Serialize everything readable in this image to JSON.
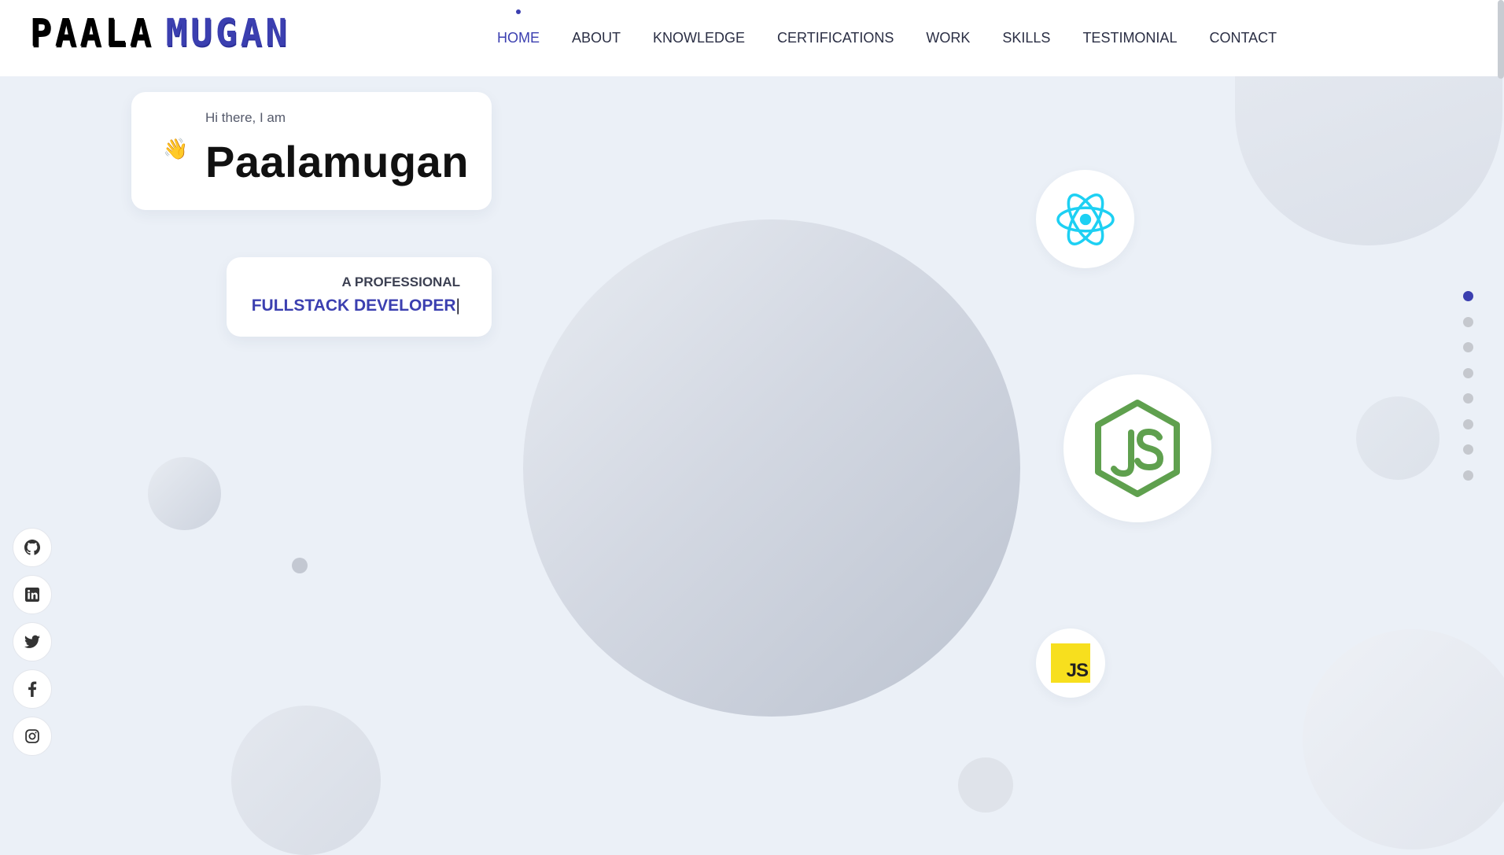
{
  "logo": {
    "part1": "PAALA",
    "part2": "MUGAN"
  },
  "nav": {
    "items": [
      {
        "label": "HOME",
        "active": true
      },
      {
        "label": "ABOUT"
      },
      {
        "label": "KNOWLEDGE"
      },
      {
        "label": "CERTIFICATIONS"
      },
      {
        "label": "WORK"
      },
      {
        "label": "SKILLS"
      },
      {
        "label": "TESTIMONIAL"
      },
      {
        "label": "CONTACT"
      }
    ]
  },
  "hero": {
    "greeting": "Hi there, I am",
    "wave_icon": "waving-hand",
    "name": "Paalamugan",
    "role_prefix": "A PROFESSIONAL",
    "role_title": "FULLSTACK DEVELOPER",
    "cursor": "|"
  },
  "tech_icons": [
    "react-icon",
    "nodejs-icon",
    "javascript-icon"
  ],
  "js_badge_text": "JS",
  "section_dots": {
    "count": 8,
    "active_index": 0
  },
  "social_links": [
    "github-icon",
    "linkedin-icon",
    "twitter-icon",
    "facebook-icon",
    "instagram-icon"
  ],
  "colors": {
    "accent": "#3b3fb0",
    "background": "#ebf0f7",
    "react": "#1dd0f3",
    "node": "#5fa04e",
    "js_yellow": "#f7df1e"
  }
}
